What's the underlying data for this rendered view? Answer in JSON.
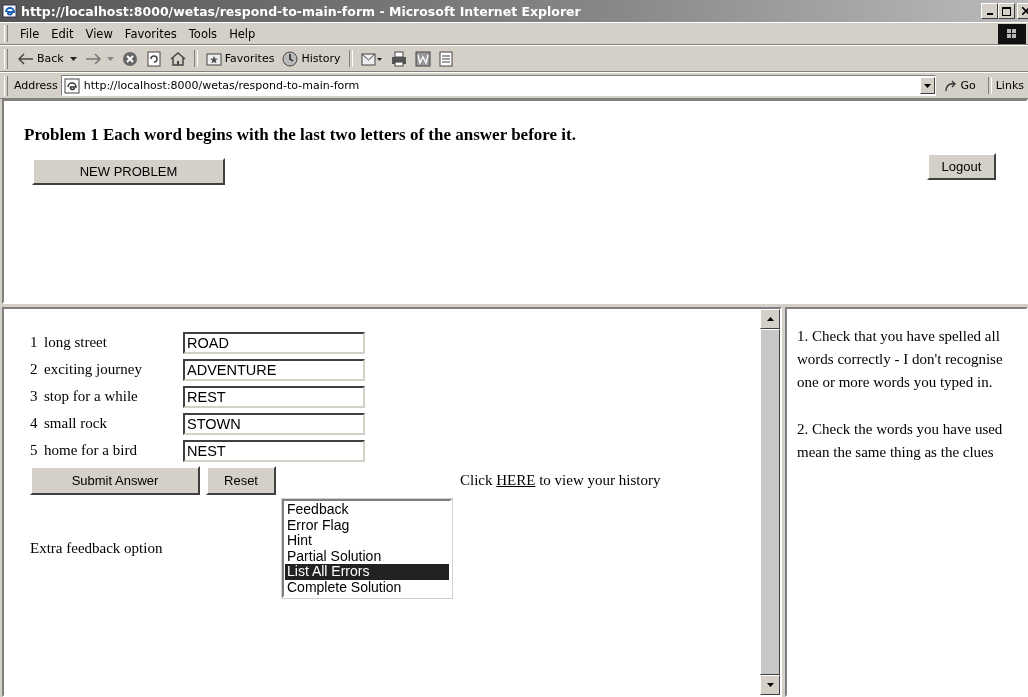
{
  "window": {
    "title": "http://localhost:8000/wetas/respond-to-main-form - Microsoft Internet Explorer"
  },
  "menu": [
    "File",
    "Edit",
    "View",
    "Favorites",
    "Tools",
    "Help"
  ],
  "toolbar": [
    {
      "kind": "back",
      "label": "Back"
    },
    {
      "kind": "forward"
    },
    {
      "kind": "stop"
    },
    {
      "kind": "refresh"
    },
    {
      "kind": "home"
    },
    {
      "kind": "sep"
    },
    {
      "kind": "favorites",
      "label": "Favorites"
    },
    {
      "kind": "history",
      "label": "History"
    },
    {
      "kind": "sep"
    },
    {
      "kind": "mail"
    },
    {
      "kind": "print"
    },
    {
      "kind": "edit"
    },
    {
      "kind": "discuss"
    }
  ],
  "address": {
    "label": "Address",
    "url": "http://localhost:8000/wetas/respond-to-main-form",
    "go": "Go",
    "links": "Links"
  },
  "problem": {
    "title": "Problem 1 Each word begins with the last two letters of the answer before it.",
    "new_button": "NEW PROBLEM",
    "logout": "Logout"
  },
  "clues": [
    {
      "number": "1",
      "clue": "long street",
      "value": "ROAD"
    },
    {
      "number": "2",
      "clue": "exciting journey",
      "value": "ADVENTURE"
    },
    {
      "number": "3",
      "clue": "stop for a while",
      "value": "REST"
    },
    {
      "number": "4",
      "clue": "small rock",
      "value": "STOWN"
    },
    {
      "number": "5",
      "clue": "home for a bird",
      "value": "NEST"
    }
  ],
  "buttons": {
    "submit": "Submit Answer",
    "reset": "Reset"
  },
  "history": {
    "before": "Click",
    "link": "HERE",
    "after": "to view your history"
  },
  "feedback": {
    "label": "Extra feedback option",
    "options": [
      {
        "label": "Feedback",
        "selected": false
      },
      {
        "label": "Error Flag",
        "selected": false
      },
      {
        "label": "Hint",
        "selected": false
      },
      {
        "label": "Partial Solution",
        "selected": false
      },
      {
        "label": "List All Errors",
        "selected": true
      },
      {
        "label": "Complete Solution",
        "selected": false
      }
    ]
  },
  "messages": [
    "1. Check that you have spelled all words correctly - I don't recognise one or more words you typed in.",
    "2. Check the words you have used mean the same thing as the clues"
  ]
}
